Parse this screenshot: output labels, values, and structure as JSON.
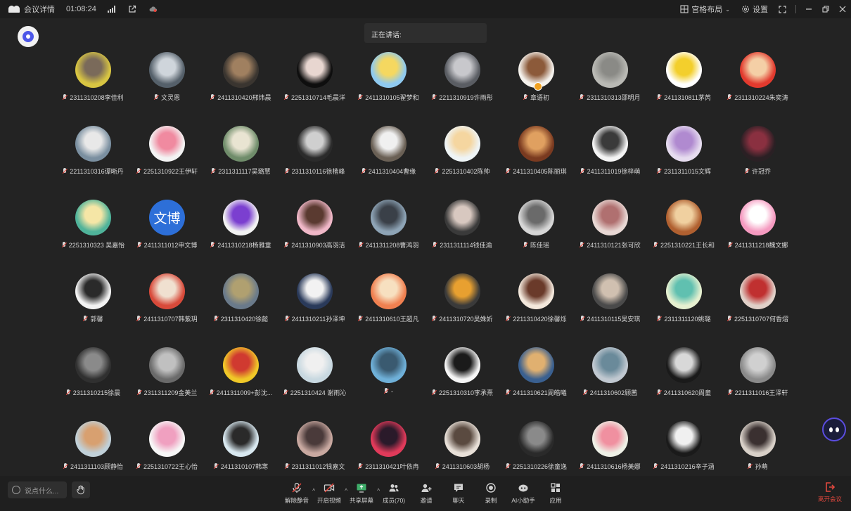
{
  "titlebar": {
    "meeting_details": "会议详情",
    "elapsed_time": "01:08:24",
    "layout_label": "宫格布局",
    "settings_label": "设置"
  },
  "speaking": {
    "label": "正在讲话:"
  },
  "participants": [
    {
      "name": "2311310208李佳利",
      "colors": [
        "#d8c542",
        "#7a6a5a"
      ]
    },
    {
      "name": "文灵恩",
      "colors": [
        "#55606a",
        "#cfd5db"
      ]
    },
    {
      "name": "2411310420邢炜晨",
      "colors": [
        "#3a3530",
        "#a08060"
      ]
    },
    {
      "name": "2251310714毛晨洋",
      "colors": [
        "#0e0e0e",
        "#e8d6d0"
      ]
    },
    {
      "name": "2411310105翟梦和",
      "colors": [
        "#8fcaf0",
        "#f5d860"
      ]
    },
    {
      "name": "2211310919许雨彤",
      "colors": [
        "#5a5d63",
        "#c8c8cc"
      ]
    },
    {
      "name": "章语初",
      "colors": [
        "#f4f1ec",
        "#8c5a3a"
      ],
      "host": true
    },
    {
      "name": "2311310313邵明月",
      "colors": [
        "#b9b9b4",
        "#8a8a86"
      ]
    },
    {
      "name": "2411310811茅芮",
      "colors": [
        "#ffffff",
        "#f3cf2c"
      ]
    },
    {
      "name": "2311310224朱奕涛",
      "colors": [
        "#e23a2e",
        "#f4cfa6"
      ]
    },
    {
      "name": "2211310316谭晰丹",
      "colors": [
        "#7a8fa0",
        "#e8e8e8"
      ]
    },
    {
      "name": "2251310922王伊轩",
      "colors": [
        "#f3f3f3",
        "#f08aa0"
      ]
    },
    {
      "name": "2311311117吴璐慧",
      "colors": [
        "#6f8c6a",
        "#e9e4d2"
      ]
    },
    {
      "name": "2311310116徐楷峰",
      "colors": [
        "#2b2b2b",
        "#cfcfcf"
      ]
    },
    {
      "name": "2411310404曹缘",
      "colors": [
        "#6a6055",
        "#f0f0f0"
      ]
    },
    {
      "name": "2251310402陈帅",
      "colors": [
        "#eef4f6",
        "#f5d6a0"
      ]
    },
    {
      "name": "2411310405陈丽琪",
      "colors": [
        "#7a3a20",
        "#e0a060"
      ]
    },
    {
      "name": "2411311019徐梓萌",
      "colors": [
        "#f4f4f4",
        "#3a3a3a"
      ]
    },
    {
      "name": "2311311015文辉",
      "colors": [
        "#e6dcef",
        "#b08ad0"
      ]
    },
    {
      "name": "许冠乔",
      "colors": [
        "#2a2024",
        "#8a3040"
      ]
    },
    {
      "name": "2251310323 吴嘉怡",
      "colors": [
        "#4fb39a",
        "#f5e6a6"
      ]
    },
    {
      "name": "2411311012申文博",
      "colors": [
        "#2d6fd8",
        "#2d6fd8"
      ],
      "text": "文博"
    },
    {
      "name": "2411310218杨雅童",
      "colors": [
        "#f2f2f2",
        "#7b3fd0"
      ]
    },
    {
      "name": "2411310903高羽洁",
      "colors": [
        "#f0b8c8",
        "#5a3a30"
      ]
    },
    {
      "name": "2411311208曹鸿羽",
      "colors": [
        "#8ea4b6",
        "#3a4048"
      ]
    },
    {
      "name": "2311311114钱佳渝",
      "colors": [
        "#3a3a3a",
        "#d8c8c0"
      ]
    },
    {
      "name": "陈佳瑶",
      "colors": [
        "#d6d6d6",
        "#6a6a6a"
      ]
    },
    {
      "name": "2411310121张可欣",
      "colors": [
        "#e8d8d4",
        "#b07070"
      ]
    },
    {
      "name": "2251310221王长和",
      "colors": [
        "#b06030",
        "#f0d0a0"
      ]
    },
    {
      "name": "2411311218魏文娜",
      "colors": [
        "#f59ac0",
        "#ffffff"
      ]
    },
    {
      "name": "郭馨",
      "colors": [
        "#f2f2f2",
        "#2a2a2a"
      ]
    },
    {
      "name": "2411310707韩紫玥",
      "colors": [
        "#d84a3a",
        "#f0e0d0"
      ]
    },
    {
      "name": "2311310420徐懿",
      "colors": [
        "#6a7a8a",
        "#b0a070"
      ]
    },
    {
      "name": "2411310211孙泽坤",
      "colors": [
        "#2a3a5a",
        "#f2f2f2"
      ]
    },
    {
      "name": "2411310610王超凡",
      "colors": [
        "#f08050",
        "#f7e0c0"
      ]
    },
    {
      "name": "2411310720吴姝妡",
      "colors": [
        "#3a3a3a",
        "#e8a030"
      ]
    },
    {
      "name": "2211310420徐馨烁",
      "colors": [
        "#f3e8dc",
        "#6a3a2a"
      ]
    },
    {
      "name": "2411310115吴安琪",
      "colors": [
        "#4a4a4a",
        "#d0c0b0"
      ]
    },
    {
      "name": "2311311120姚璐",
      "colors": [
        "#e6f0d0",
        "#60c0b0"
      ]
    },
    {
      "name": "2251310707何香熠",
      "colors": [
        "#e0d0c8",
        "#c03030"
      ]
    },
    {
      "name": "2311310215徐晨",
      "colors": [
        "#303030",
        "#8a8a8a"
      ]
    },
    {
      "name": "2311311209金美兰",
      "colors": [
        "#6a6a6a",
        "#c0c0c0"
      ]
    },
    {
      "name": "2411311009+彭沈...",
      "colors": [
        "#f0c828",
        "#d03a30"
      ]
    },
    {
      "name": "2251310424 谢雨沁",
      "colors": [
        "#c8d8e0",
        "#f0f0f0"
      ]
    },
    {
      "name": "-",
      "colors": [
        "#6fb0d8",
        "#3a5a70"
      ]
    },
    {
      "name": "2251310310李承熹",
      "colors": [
        "#f6f6f6",
        "#1a1a1a"
      ]
    },
    {
      "name": "2411310621周皓曦",
      "colors": [
        "#3a6090",
        "#e0b070"
      ]
    },
    {
      "name": "2411310602顾茜",
      "colors": [
        "#c0c8d0",
        "#6a8a9a"
      ]
    },
    {
      "name": "2411310620周童",
      "colors": [
        "#1a1a1a",
        "#d8d8d8"
      ]
    },
    {
      "name": "2211311016王泽轩",
      "colors": [
        "#8a8a8a",
        "#d0d0d0"
      ]
    },
    {
      "name": "2411311103顾静怡",
      "colors": [
        "#c0d0d8",
        "#d8a070"
      ]
    },
    {
      "name": "2251310722王心怡",
      "colors": [
        "#f6f6f6",
        "#f0a0c0"
      ]
    },
    {
      "name": "2411310107韩寒",
      "colors": [
        "#d8e8f0",
        "#2a2a2a"
      ]
    },
    {
      "name": "2311311012钱嘉文",
      "colors": [
        "#c8a8a0",
        "#4a3a3a"
      ]
    },
    {
      "name": "2311310421叶依冉",
      "colors": [
        "#e03a5a",
        "#2a1a2a"
      ]
    },
    {
      "name": "2411310603胡杨",
      "colors": [
        "#e8e0d8",
        "#5a4a40"
      ]
    },
    {
      "name": "2251310226徐童逸",
      "colors": [
        "#2a2a2a",
        "#8a8a8a"
      ]
    },
    {
      "name": "2411310616杨美娜",
      "colors": [
        "#eef0e6",
        "#f090a0"
      ]
    },
    {
      "name": "2411310216辛子涵",
      "colors": [
        "#1a1a1a",
        "#f0f0f0"
      ]
    },
    {
      "name": "孙萌",
      "colors": [
        "#d8d0c8",
        "#3a3030"
      ]
    }
  ],
  "bottombar": {
    "chat_placeholder": "说点什么...",
    "tools": [
      {
        "name": "unmute",
        "label": "解除静音",
        "caret": true
      },
      {
        "name": "start-video",
        "label": "开启视频",
        "caret": true
      },
      {
        "name": "share-screen",
        "label": "共享屏幕",
        "caret": true
      },
      {
        "name": "members",
        "label": "成员(70)"
      },
      {
        "name": "invite",
        "label": "邀请"
      },
      {
        "name": "chat",
        "label": "聊天"
      },
      {
        "name": "record",
        "label": "录制"
      },
      {
        "name": "ai-assistant",
        "label": "AI小助手"
      },
      {
        "name": "apps",
        "label": "应用"
      }
    ],
    "leave_label": "离开会议"
  },
  "colors": {
    "background": "#232323",
    "toolbar": "#1f1f1f",
    "leave": "#e2483e",
    "mic_muted": "#e9473d"
  }
}
